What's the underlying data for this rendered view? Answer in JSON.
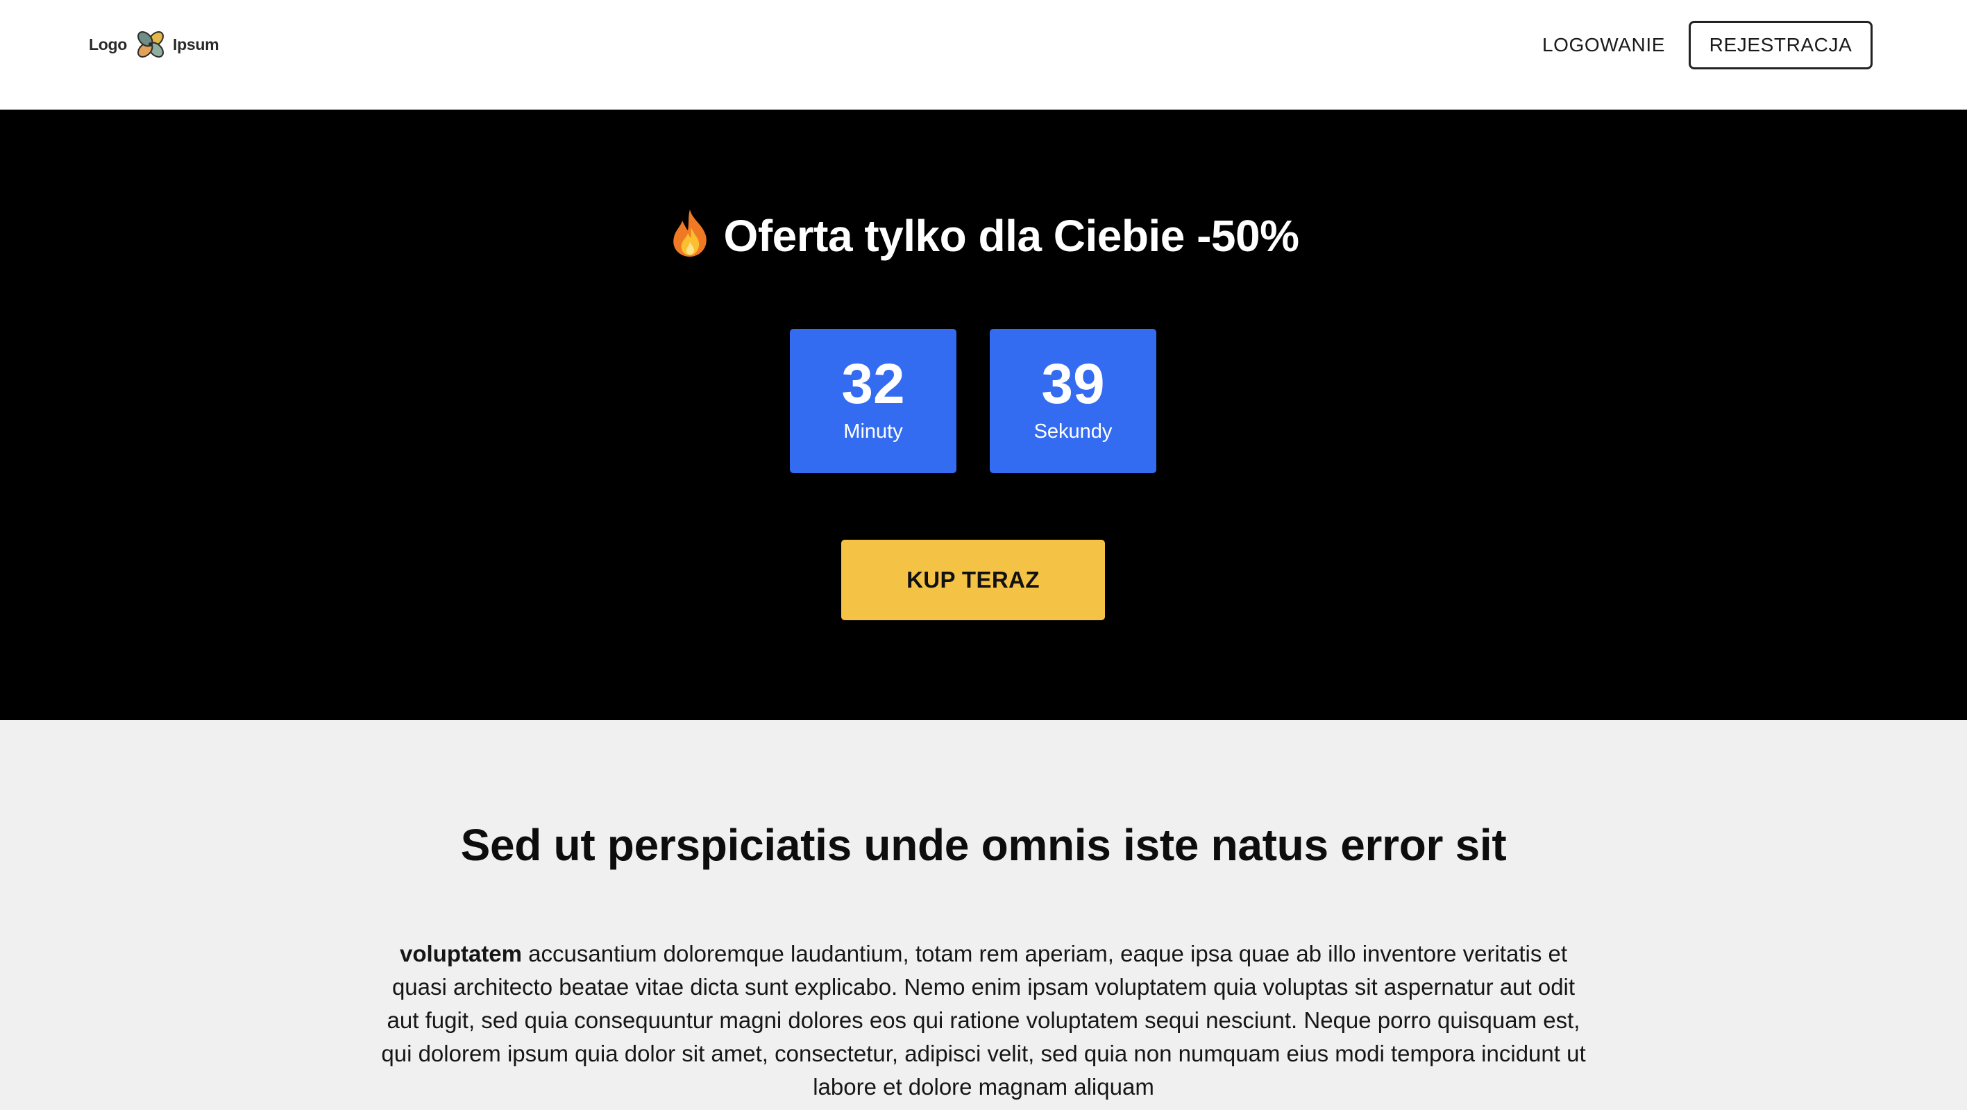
{
  "header": {
    "logo": {
      "left_word": "Logo",
      "right_word": "Ipsum",
      "icon": "clover-logo-icon"
    },
    "nav": {
      "login_label": "LOGOWANIE",
      "register_label": "REJESTRACJA"
    }
  },
  "hero": {
    "title_icon": "fire-icon",
    "title": "Oferta tylko dla Ciebie -50%",
    "timer": {
      "minutes_value": "32",
      "minutes_label": "Minuty",
      "seconds_value": "39",
      "seconds_label": "Sekundy"
    },
    "cta_label": "KUP TERAZ"
  },
  "content": {
    "heading": "Sed ut perspiciatis unde omnis iste natus error sit",
    "lead_bold": "voluptatem",
    "body": " accusantium doloremque laudantium, totam rem aperiam, eaque ipsa quae ab illo inventore veritatis et quasi architecto beatae vitae dicta sunt explicabo. Nemo enim ipsam voluptatem quia voluptas sit aspernatur aut odit aut fugit, sed quia consequuntur magni dolores eos qui ratione voluptatem sequi nesciunt. Neque porro quisquam est, qui dolorem ipsum quia dolor sit amet, consectetur, adipisci velit, sed quia non numquam eius modi tempora incidunt ut labore et dolore magnam aliquam"
  },
  "colors": {
    "header_bg": "#ffffff",
    "hero_bg": "#000000",
    "timer_bg": "#336cf0",
    "cta_bg": "#f4c245",
    "content_bg": "#f0f0f0"
  }
}
